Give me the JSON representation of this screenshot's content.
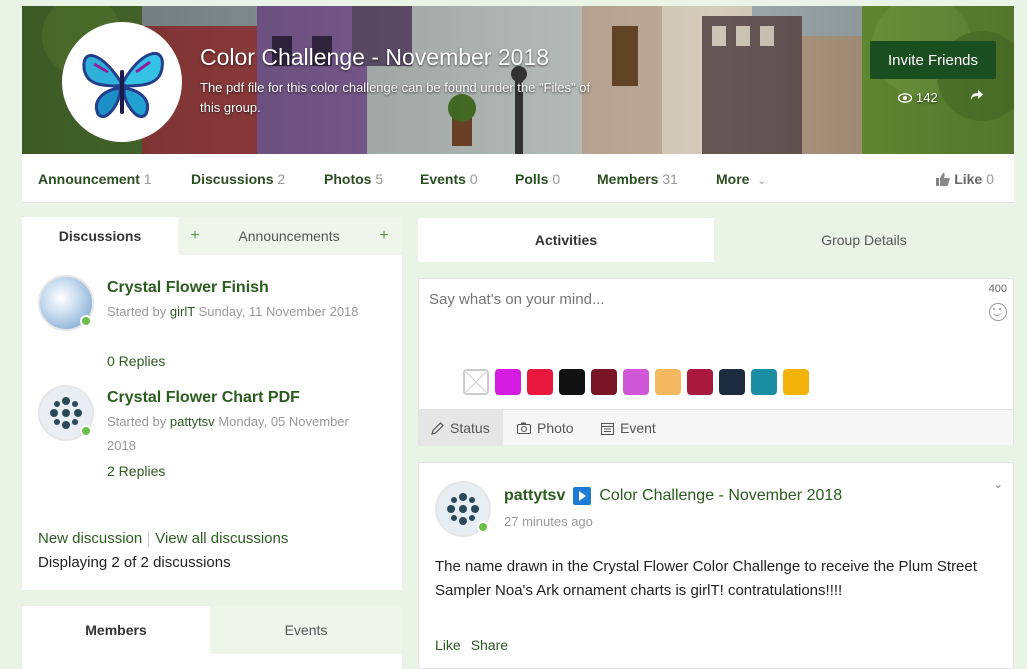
{
  "group": {
    "title": "Color Challenge - November 2018",
    "description": "The pdf file for this color challenge can be found under the \"Files\" of this group.",
    "invite_label": "Invite Friends",
    "views": "142"
  },
  "tabs": [
    {
      "label": "Announcement",
      "count": "1"
    },
    {
      "label": "Discussions",
      "count": "2"
    },
    {
      "label": "Photos",
      "count": "5"
    },
    {
      "label": "Events",
      "count": "0"
    },
    {
      "label": "Polls",
      "count": "0"
    },
    {
      "label": "Members",
      "count": "31"
    },
    {
      "label": "More",
      "count": ""
    }
  ],
  "like": {
    "label": "Like",
    "count": "0"
  },
  "left": {
    "tab_discussions": "Discussions",
    "tab_announcements": "Announcements",
    "discussions": [
      {
        "title": "Crystal Flower Finish",
        "started_by": "Started by",
        "author": "girlT",
        "date": "Sunday, 11 November 2018",
        "replies": "0 Replies"
      },
      {
        "title": "Crystal Flower Chart PDF",
        "started_by": "Started by",
        "author": "pattytsv",
        "date": "Monday, 05 November 2018",
        "replies": "2 Replies"
      }
    ],
    "new_discussion": "New discussion",
    "view_all": "View all discussions",
    "displaying": "Displaying 2 of 2 discussions",
    "tab_members": "Members",
    "tab_events": "Events"
  },
  "right": {
    "tab_activities": "Activities",
    "tab_group_details": "Group Details",
    "composer_placeholder": "Say what's on your mind...",
    "char_count": "400",
    "btn_status": "Status",
    "btn_photo": "Photo",
    "btn_event": "Event",
    "swatch_colors": [
      "#ffffff",
      "#d41be0",
      "#e8173d",
      "#111111",
      "#7a1427",
      "#d058d8",
      "#f3b860",
      "#a8183f",
      "#1c2c3e",
      "#1a8fa3",
      "#f2b40a"
    ]
  },
  "post": {
    "author": "pattytsv",
    "group": "Color Challenge - November 2018",
    "time": "27 minutes ago",
    "body": "The name drawn in the Crystal Flower Color Challenge to receive the Plum Street Sampler Noa's Ark ornament charts is girlT! contratulations!!!!",
    "like": "Like",
    "share": "Share"
  }
}
